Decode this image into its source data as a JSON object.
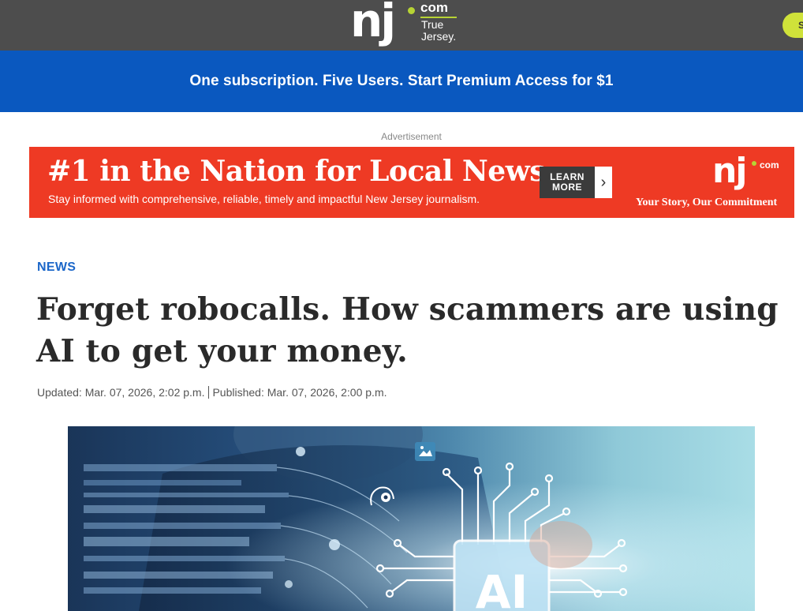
{
  "header": {
    "logo_text": "nj",
    "logo_com": "com",
    "logo_tagline": "True Jersey.",
    "signin_label": "S"
  },
  "subscription_banner": {
    "text": "One subscription. Five Users. Start Premium Access for $1"
  },
  "advertisement": {
    "label": "Advertisement",
    "headline": "#1 in the Nation for Local News",
    "subtext": "Stay informed with comprehensive, reliable, timely and impactful New Jersey journalism.",
    "cta_label": "LEARN MORE",
    "cta_arrow": "›",
    "logo_text": "nj",
    "logo_com": "com",
    "tagline": "Your Story, Our Commitment",
    "colors": {
      "background": "#ee3a24",
      "cta_box": "#3b3b3b"
    }
  },
  "article": {
    "section": "NEWS",
    "headline": "Forget robocalls. How scammers are using AI to get your money.",
    "updated": "Updated: Mar. 07, 2026, 2:02 p.m.",
    "published": "Published: Mar. 07, 2026, 2:00 p.m.",
    "hero_image": {
      "chip_text": "AI",
      "icons": [
        "gear-head-icon",
        "image-icon"
      ]
    }
  },
  "colors": {
    "header_bg": "#4d4d4d",
    "banner_bg": "#0a58bf",
    "section_label": "#1c67c9",
    "logo_accent": "#b7d334"
  }
}
